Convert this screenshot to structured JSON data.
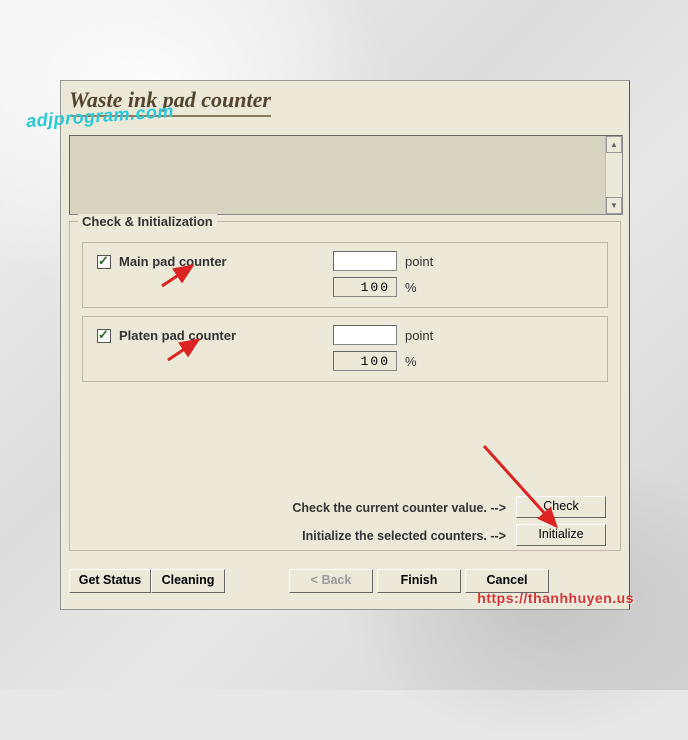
{
  "title": "Waste ink pad counter",
  "fieldset_legend": "Check & Initialization",
  "counters": {
    "main": {
      "label": "Main pad counter",
      "point_value": "",
      "percent_value": "100",
      "point_unit": "point",
      "percent_unit": "%"
    },
    "platen": {
      "label": "Platen pad counter",
      "point_value": "",
      "percent_value": "100",
      "point_unit": "point",
      "percent_unit": "%"
    }
  },
  "instructions": {
    "check": "Check the current counter value. -->",
    "initialize": "Initialize the selected counters. -->"
  },
  "buttons": {
    "check": "Check",
    "initialize": "Initialize",
    "get_status": "Get Status",
    "cleaning": "Cleaning",
    "back": "< Back",
    "finish": "Finish",
    "cancel": "Cancel"
  },
  "watermarks": {
    "top": "adjprogram.com",
    "bottom": "https://thanhhuyen.us"
  }
}
